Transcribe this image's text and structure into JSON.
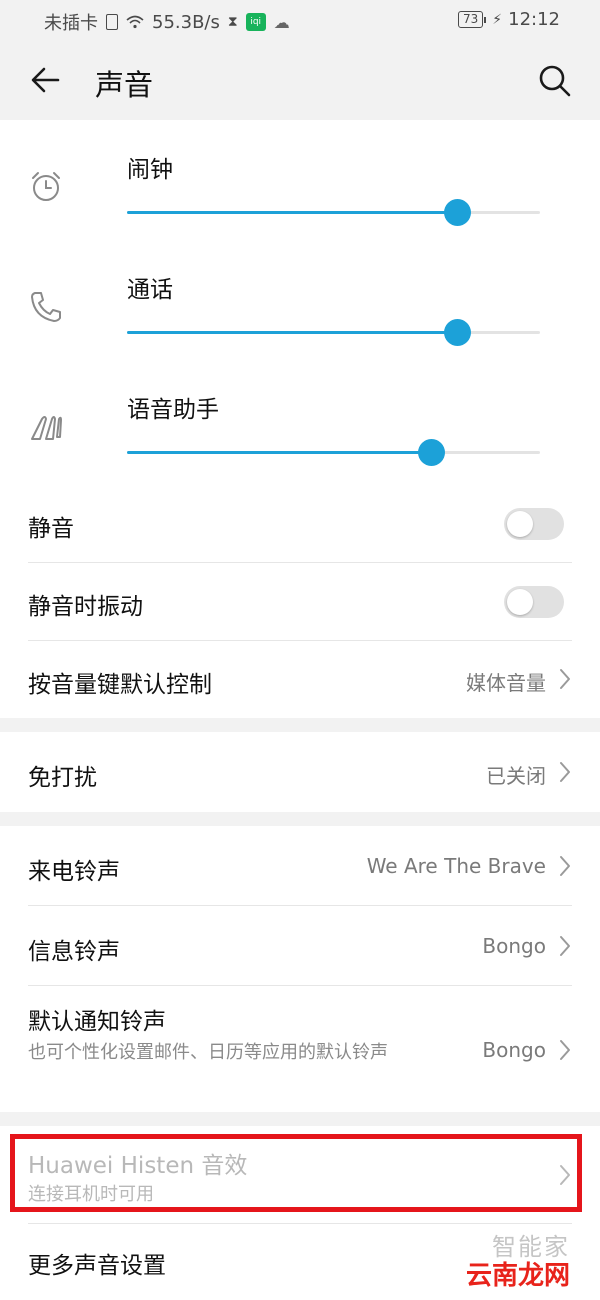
{
  "status_bar": {
    "carrier": "未插卡",
    "speed": "55.3B/s",
    "app_badge": "iqi",
    "battery": "73",
    "time": "12:12"
  },
  "header": {
    "title": "声音"
  },
  "volumes": [
    {
      "label": "闹钟",
      "icon": "alarm-clock-icon",
      "level": 0.8
    },
    {
      "label": "通话",
      "icon": "phone-icon",
      "level": 0.8
    },
    {
      "label": "语音助手",
      "icon": "voice-assistant-icon",
      "level": 0.735
    }
  ],
  "toggles": {
    "mute": {
      "label": "静音",
      "on": false
    },
    "vibrate_when_muted": {
      "label": "静音时振动",
      "on": false
    }
  },
  "volume_key": {
    "label": "按音量键默认控制",
    "value": "媒体音量"
  },
  "dnd": {
    "label": "免打扰",
    "value": "已关闭"
  },
  "ringtones": {
    "incoming": {
      "label": "来电铃声",
      "value": "We Are The Brave"
    },
    "message": {
      "label": "信息铃声",
      "value": "Bongo"
    },
    "notification": {
      "label": "默认通知铃声",
      "sub": "也可个性化设置邮件、日历等应用的默认铃声",
      "value": "Bongo"
    }
  },
  "histen": {
    "label": "Huawei Histen 音效",
    "sub": "连接耳机时可用"
  },
  "more": {
    "label": "更多声音设置"
  },
  "watermark": {
    "top": "智能家",
    "bottom": "云南龙网"
  },
  "colors": {
    "accent": "#1ca1d8",
    "highlight": "#e5151b"
  }
}
